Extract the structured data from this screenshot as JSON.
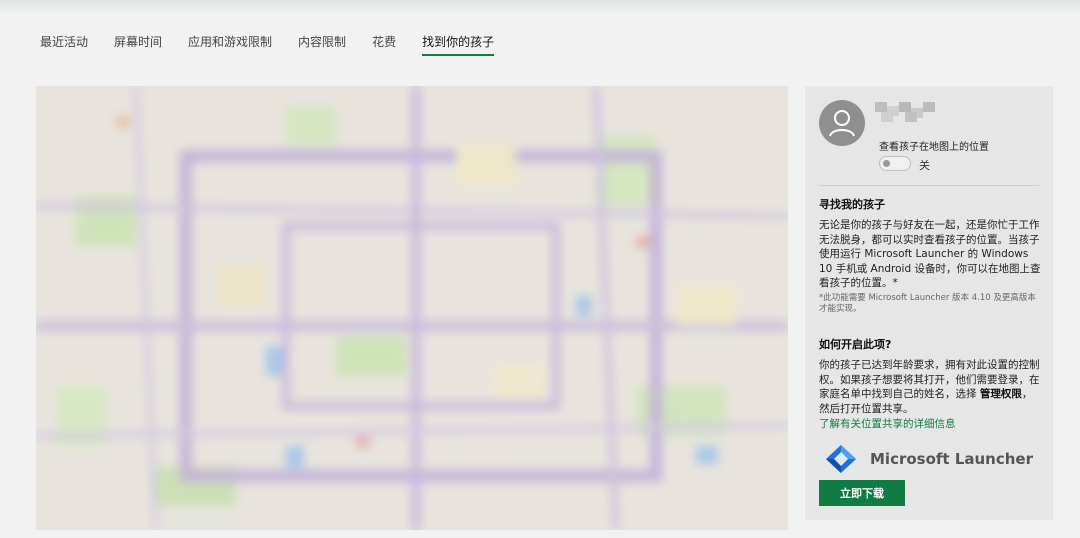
{
  "nav": {
    "tabs": [
      {
        "label": "最近活动"
      },
      {
        "label": "屏幕时间"
      },
      {
        "label": "应用和游戏限制"
      },
      {
        "label": "内容限制"
      },
      {
        "label": "花费"
      },
      {
        "label": "找到你的孩子",
        "active": true
      }
    ]
  },
  "panel": {
    "view_location_label": "查看孩子在地图上的位置",
    "toggle_state": "关",
    "find_title": "寻找我的孩子",
    "find_body": "无论是你的孩子与好友在一起，还是你忙于工作无法脱身，都可以实时查看孩子的位置。当孩子使用运行 Microsoft Launcher 的 Windows 10 手机或 Android 设备时，你可以在地图上查看孩子的位置。*",
    "find_note": "*此功能需要 Microsoft Launcher 版本 4.10 及更高版本才能实现。",
    "how_title": "如何开启此项?",
    "how_body_1": "你的孩子已达到年龄要求，拥有对此设置的控制权。如果孩子想要将其打开，他们需要登录，在家庭名单中找到自己的姓名，选择 ",
    "how_body_bold": "管理权限",
    "how_body_2": "，然后打开位置共享。",
    "learn_more_link": "了解有关位置共享的详细信息",
    "app_name": "Microsoft Launcher",
    "download_label": "立即下载"
  },
  "icons": {
    "avatar": "person-icon",
    "launcher": "microsoft-launcher-icon"
  },
  "colors": {
    "accent": "#107c41",
    "panel_bg": "#e6e6e6",
    "page_bg": "#f2f2f2"
  }
}
